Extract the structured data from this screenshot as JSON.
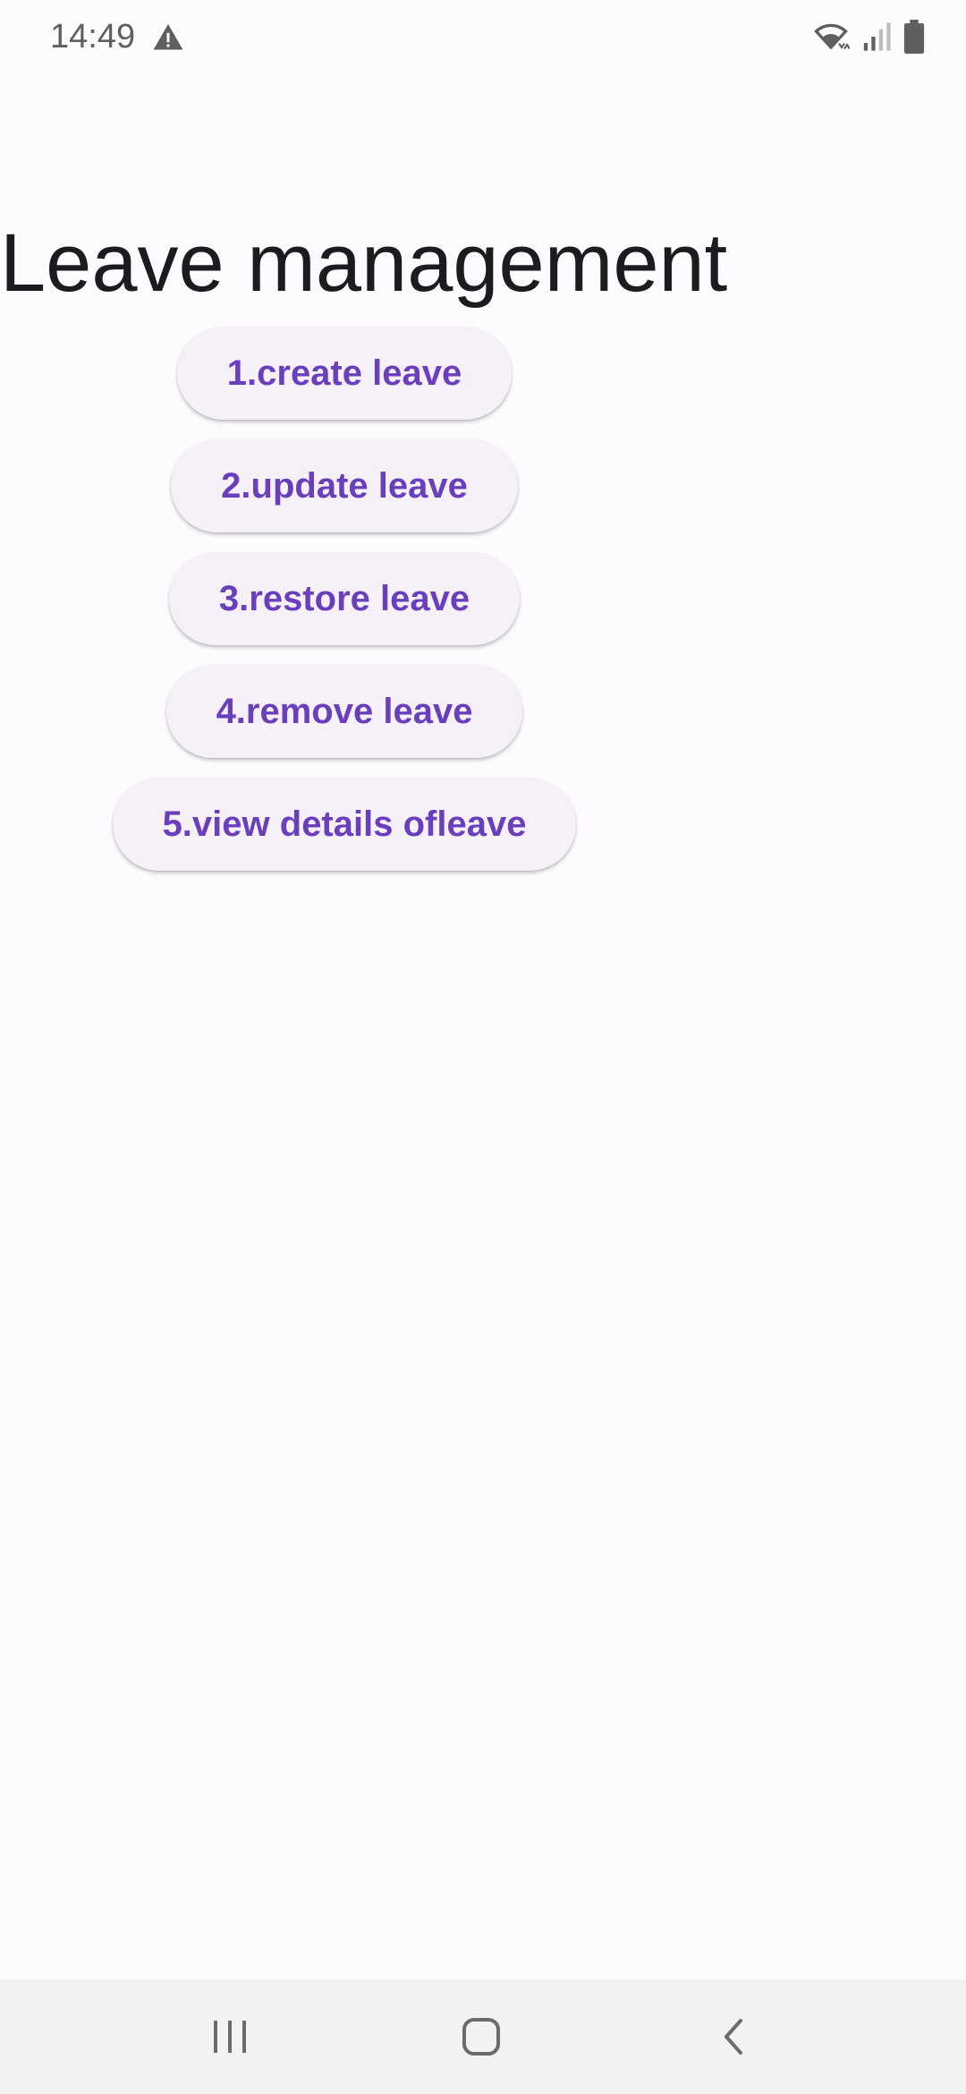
{
  "status_bar": {
    "time": "14:49",
    "warning_icon": "warning-triangle-icon",
    "wifi_icon": "wifi-icon",
    "signal_icon": "cellular-signal-icon",
    "battery_icon": "battery-icon"
  },
  "page": {
    "title": "Leave management"
  },
  "menu": {
    "items": [
      {
        "label": "1.create leave"
      },
      {
        "label": "2.update leave"
      },
      {
        "label": "3.restore leave"
      },
      {
        "label": "4.remove leave"
      },
      {
        "label": "5.view details ofleave"
      }
    ]
  },
  "nav_bar": {
    "recents_icon": "recent-apps-icon",
    "home_icon": "home-icon",
    "back_icon": "back-icon"
  },
  "colors": {
    "background": "#fefbff",
    "button_bg": "#f6f1f9",
    "button_text": "#6a3fbd",
    "title_text": "#1c1b1f",
    "nav_bg": "#f2f2f2"
  }
}
